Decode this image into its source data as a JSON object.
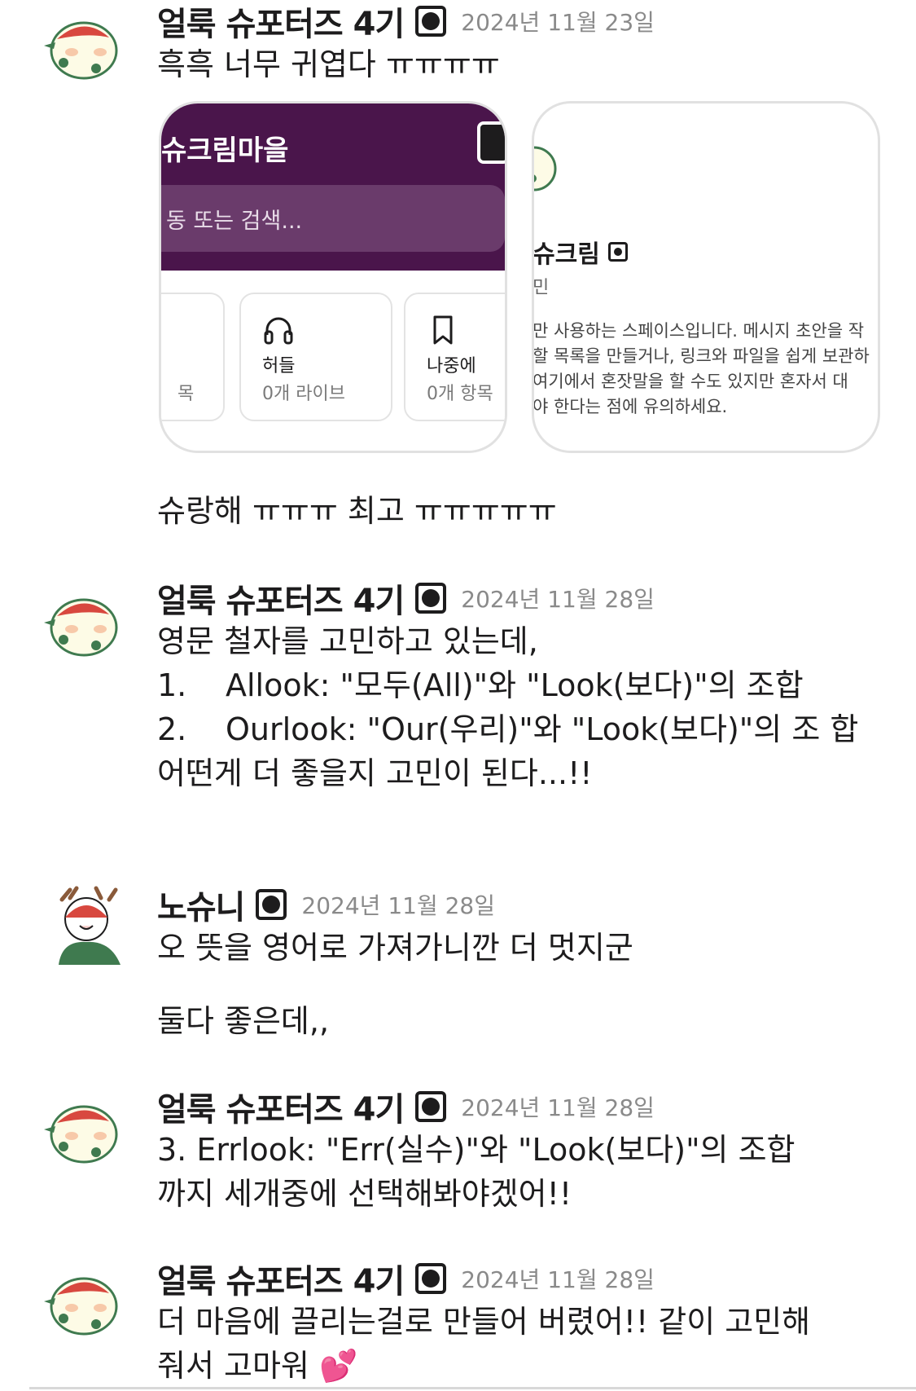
{
  "messages": [
    {
      "author": "얼룩 슈포터즈 4기",
      "time": "2024년 11월 23일",
      "lines": [
        "흑흑 너무 귀엽다 ㅠㅠㅠㅠ"
      ],
      "after": [
        "슈랑해 ㅠㅠㅠ 최고 ㅠㅠㅠㅠㅠ"
      ]
    },
    {
      "author": "얼룩 슈포터즈 4기",
      "time": "2024년 11월 28일",
      "lines": [
        "영문 철자를 고민하고 있는데,"
      ],
      "list": [
        {
          "num": "1.",
          "text": "Allook: \"모두(All)\"와 \"Look(보다)\"의 조합"
        },
        {
          "num": "2.",
          "text": "Ourlook: \"Our(우리)\"와 \"Look(보다)\"의 조 합"
        }
      ],
      "after": [
        "어떤게 더 좋을지 고민이 된다...!!"
      ]
    },
    {
      "author": "노슈니",
      "time": "2024년 11월 28일",
      "lines": [
        "오 뜻을 영어로 가져가니깐 더 멋지군",
        "둘다 좋은데,,"
      ]
    },
    {
      "author": "얼룩 슈포터즈 4기",
      "time": "2024년 11월 28일",
      "lines": [
        "3. Errlook: \"Err(실수)\"와 \"Look(보다)\"의 조합",
        "까지 세개중에 선택해봐야겠어!!"
      ]
    },
    {
      "author": "얼룩 슈포터즈 4기",
      "time": "2024년 11월 28일",
      "lines": [
        "더 마음에 끌리는걸로 만들어 버렸어!! 같이 고민해",
        "줘서 고마워 💕"
      ]
    }
  ],
  "preview": {
    "workspace_name": "슈크림마을",
    "search_placeholder": "동 또는 검색...",
    "tiles": [
      {
        "title": "",
        "sub": "목"
      },
      {
        "title": "허들",
        "sub": "0개 라이브",
        "icon": "headphones-icon"
      },
      {
        "title": "나중에",
        "sub": "0개 항목",
        "icon": "bookmark-icon"
      }
    ],
    "profile_name": "슈크림",
    "profile_role": "민",
    "profile_desc": [
      "만 사용하는 스페이스입니다. 메시지 초안을 작",
      "할 목록을 만들거나, 링크와 파일을 쉽게 보관하",
      "여기에서 혼잣말을 할 수도 있지만 혼자서 대",
      "야 한다는 점에 유의하세요."
    ]
  },
  "colors": {
    "slack_purple": "#4a154b",
    "search_purple": "#6a3b6b",
    "timestamp_gray": "#8a8a8a",
    "avatar_green": "#3f7a4f"
  }
}
